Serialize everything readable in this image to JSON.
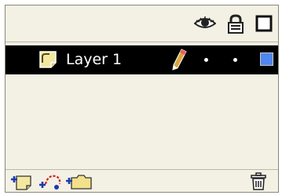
{
  "panel": {
    "header": {
      "icons": [
        "eye-icon",
        "lock-icon",
        "outline-icon"
      ]
    },
    "layers": [
      {
        "name": "Layer 1",
        "selected": true,
        "icon": "layer-page-icon",
        "edit_icon": "pencil-icon",
        "visible_marker": "dot",
        "lock_marker": "dot",
        "outline_color": "#4f86f0"
      }
    ],
    "footer": {
      "icons": [
        "add-layer-icon",
        "add-guide-layer-icon",
        "add-folder-icon",
        "trash-icon"
      ]
    }
  },
  "colors": {
    "panel_bg": "#f3f1e4",
    "selected_row_bg": "#000000",
    "selected_row_text": "#ffffff",
    "border": "#8a877a"
  }
}
